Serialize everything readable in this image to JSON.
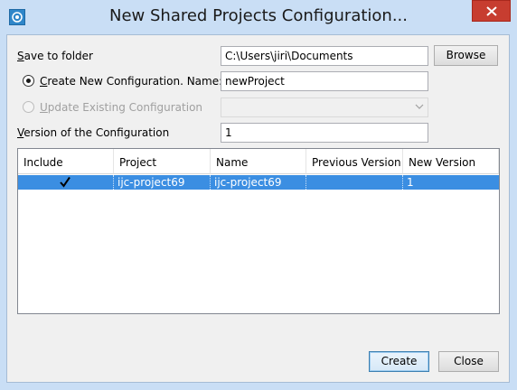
{
  "window": {
    "title": "New Shared Projects Configuration..."
  },
  "form": {
    "save_label": "Save to folder",
    "save_path": "C:\\Users\\jiri\\Documents",
    "browse_label": "Browse",
    "create_new_label": "Create New Configuration. Name:",
    "config_name": "newProject",
    "update_existing_label": "Update Existing Configuration",
    "update_existing_value": "",
    "version_label": "Version of the Configuration",
    "version_value": "1",
    "create_new_selected": true
  },
  "table": {
    "columns": [
      "Include",
      "Project",
      "Name",
      "Previous Version",
      "New Version"
    ],
    "rows": [
      {
        "include": true,
        "project": "ijc-project69",
        "name": "ijc-project69",
        "previous_version": "",
        "new_version": "1",
        "selected": true
      }
    ]
  },
  "buttons": {
    "create": "Create",
    "close": "Close"
  },
  "colors": {
    "selection": "#3b8ee2",
    "close_button": "#c73d30",
    "titlebar": "#c9def5"
  },
  "icons": {
    "app": "app-icon",
    "close": "close-icon",
    "check": "check-icon",
    "dropdown": "chevron-down-icon"
  }
}
